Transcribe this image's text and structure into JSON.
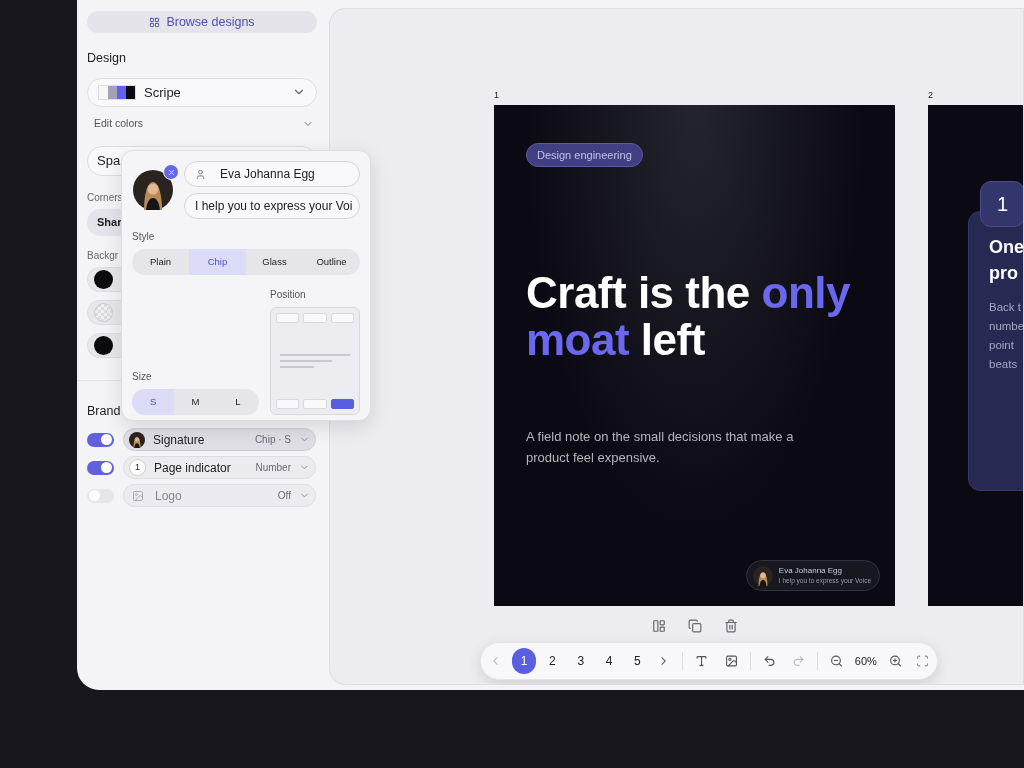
{
  "sidebar": {
    "browse_button": "Browse designs",
    "design_label": "Design",
    "design_select": {
      "value": "Scripe",
      "swatches": [
        {
          "color": "#f7f7f9"
        },
        {
          "color": "#a3a3b8"
        },
        {
          "color": "#6161ee"
        },
        {
          "color": "#0b0b0f"
        }
      ]
    },
    "edit_colors": "Edit colors",
    "spacing_field": "Spa",
    "corners_label": "Corners",
    "corners_value": "Shar",
    "background_label": "Backgr",
    "backgrounds": [
      {
        "kind": "solid",
        "color": "#0b0b0f"
      },
      {
        "kind": "transparent"
      },
      {
        "kind": "solid",
        "color": "#0b0b0f"
      }
    ],
    "brand_label": "Brand",
    "brand_items": [
      {
        "kind": "avatar",
        "label": "Signature",
        "value": "Chip · S",
        "on": true,
        "selected": true
      },
      {
        "kind": "number",
        "badge": "1",
        "label": "Page indicator",
        "value": "Number",
        "on": true,
        "selected": false
      },
      {
        "kind": "image",
        "label": "Logo",
        "value": "Off",
        "on": false,
        "selected": false
      }
    ]
  },
  "popover": {
    "name": "Eva Johanna Egg",
    "bio": "I help you to express your Voi",
    "style_label": "Style",
    "styles": [
      {
        "label": "Plain",
        "selected": false
      },
      {
        "label": "Chip",
        "selected": true
      },
      {
        "label": "Glass",
        "selected": false
      },
      {
        "label": "Outline",
        "selected": false
      }
    ],
    "position_label": "Position",
    "positions": [
      {
        "selected": false
      },
      {
        "selected": false
      },
      {
        "selected": false
      },
      {
        "selected": false
      },
      {
        "selected": false
      },
      {
        "selected": true
      }
    ],
    "size_label": "Size",
    "sizes": [
      {
        "label": "S",
        "selected": true
      },
      {
        "label": "M",
        "selected": false
      },
      {
        "label": "L",
        "selected": false
      }
    ]
  },
  "canvas": {
    "slide_1": {
      "number": "1",
      "tag": "Design engineering",
      "headline": [
        {
          "text": "Craft is the ",
          "accent": false
        },
        {
          "text": "only moat",
          "accent": true
        },
        {
          "text": " left",
          "accent": false
        }
      ],
      "subtitle": "A field note on the small decisions that make a product feel expensive.",
      "signature": {
        "name": "Eva Johanna Egg",
        "bio": "I help you to express your Voice"
      }
    },
    "slide_2": {
      "number": "2",
      "page_badge": "1",
      "title_lines": [
        "One",
        "pro"
      ],
      "body_lines": [
        "Back t",
        "numbe",
        "point",
        "beats"
      ]
    },
    "toolbar": {
      "pages": [
        {
          "label": "1",
          "selected": true
        },
        {
          "label": "2",
          "selected": false
        },
        {
          "label": "3",
          "selected": false
        },
        {
          "label": "4",
          "selected": false
        },
        {
          "label": "5",
          "selected": false
        }
      ],
      "zoom": "60%"
    }
  }
}
